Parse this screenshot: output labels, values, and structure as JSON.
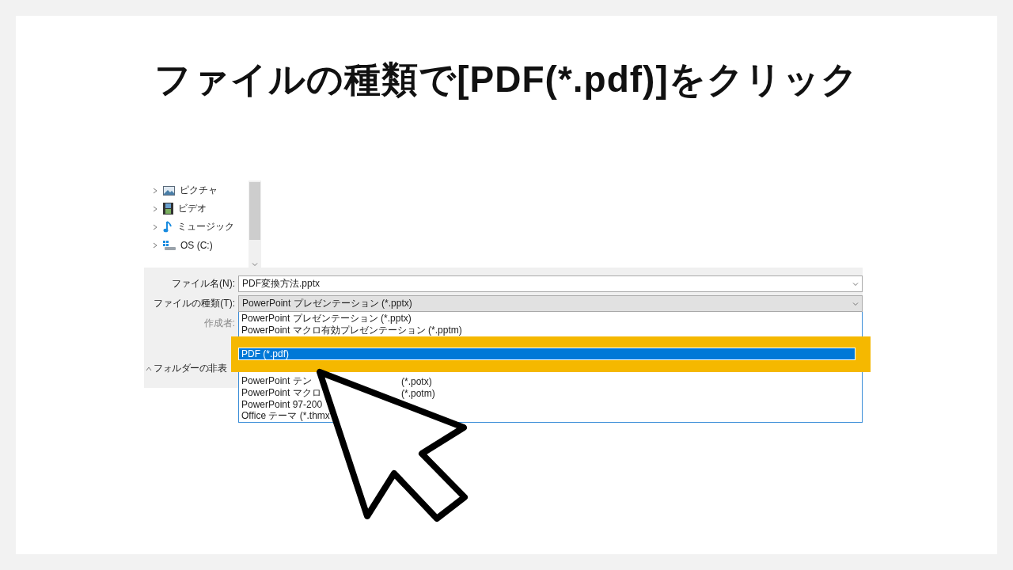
{
  "title": "ファイルの種類で[PDF(*.pdf)]をクリック",
  "nav_tree": {
    "items": [
      {
        "label": "ピクチャ",
        "kind": "pictures"
      },
      {
        "label": "ビデオ",
        "kind": "videos"
      },
      {
        "label": "ミュージック",
        "kind": "music"
      },
      {
        "label": "OS (C:)",
        "kind": "drive"
      }
    ]
  },
  "form": {
    "fields": [
      {
        "label": "ファイル名(N):",
        "value": "PDF変換方法.pptx",
        "kind": "text"
      },
      {
        "label": "ファイルの種類(T):",
        "value": "PowerPoint プレゼンテーション (*.pptx)",
        "kind": "select"
      }
    ],
    "author_label": "作成者:",
    "hide_folders": "フォルダーの非表"
  },
  "file_type_list": {
    "items": [
      {
        "label": "PowerPoint プレゼンテーション (*.pptx)",
        "selected": false
      },
      {
        "label": "PowerPoint マクロ有効プレゼンテーション (*.pptm)",
        "selected": false
      },
      {
        "label": "PDF (*.pdf)",
        "selected": true
      },
      {
        "label": "PowerPoint テン",
        "suffix": "(*.potx)",
        "selected": false
      },
      {
        "label": "PowerPoint マクロ",
        "suffix": "(*.potm)",
        "selected": false
      },
      {
        "label": "PowerPoint 97-200",
        "selected": false
      },
      {
        "label": "Office テーマ (*.thmx",
        "selected": false
      }
    ]
  }
}
